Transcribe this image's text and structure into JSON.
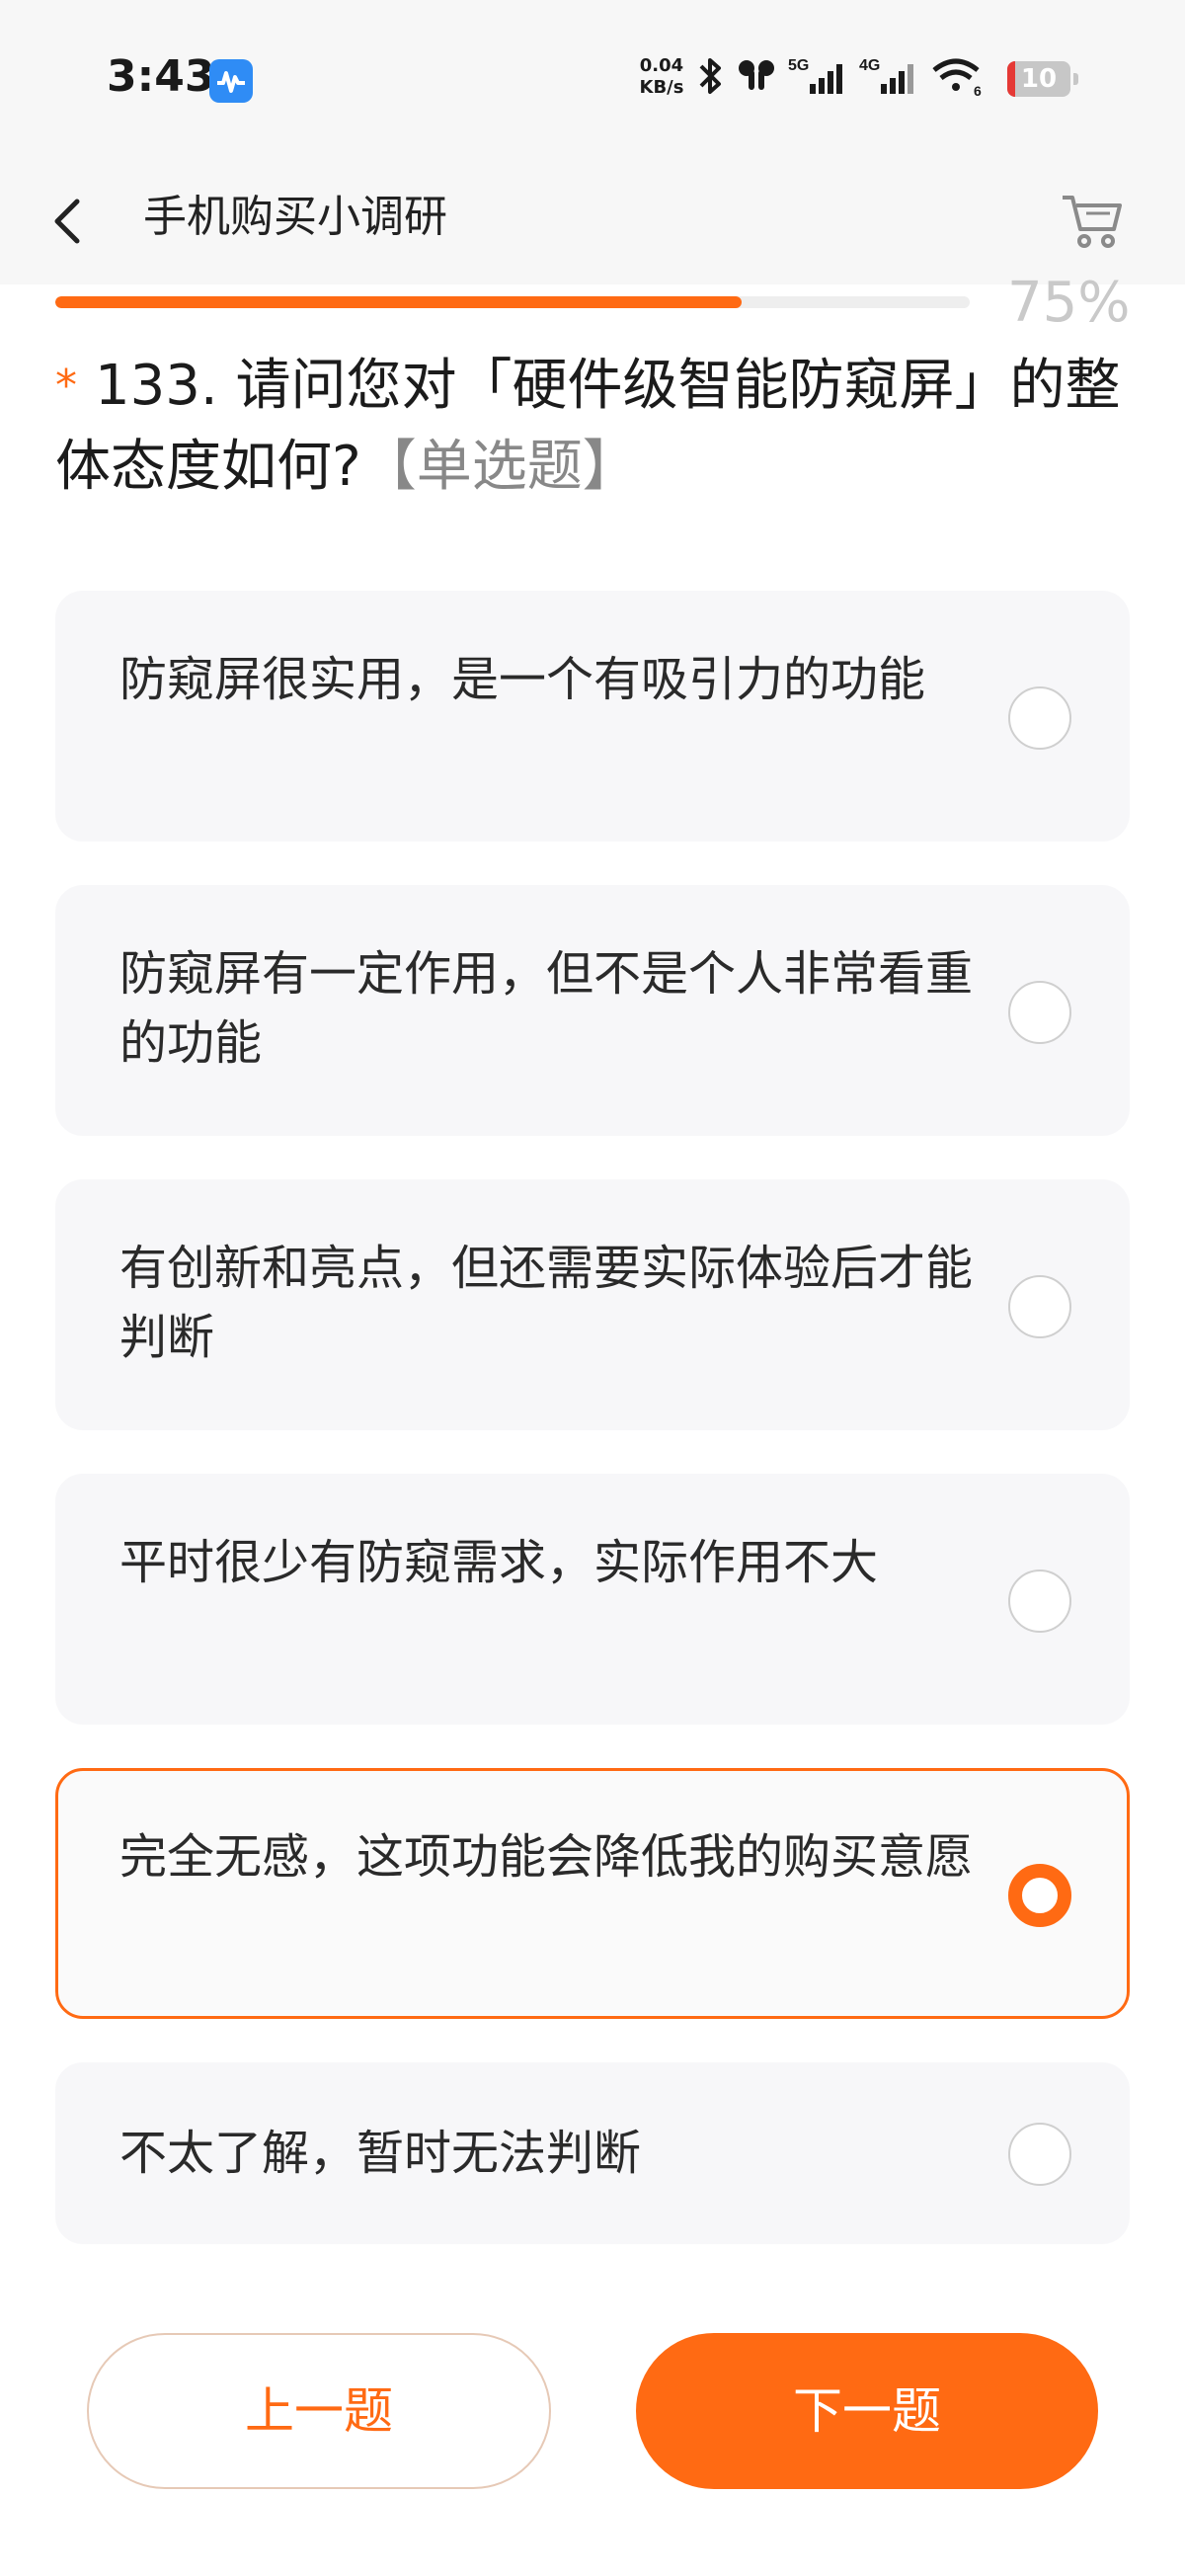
{
  "status_bar": {
    "time": "3:43",
    "net_speed_value": "0.04",
    "net_speed_unit": "KB/s",
    "network_5g": "5G",
    "network_4g": "4G",
    "wifi_label": "6",
    "battery": "10"
  },
  "header": {
    "title": "手机购买小调研"
  },
  "progress": {
    "percent_label": "75%",
    "fraction": 0.75
  },
  "question": {
    "star": "*",
    "text": "133. 请问您对「硬件级智能防窥屏」的整体态度如何?",
    "type_label": "【单选题】"
  },
  "options": [
    {
      "label": "防窥屏很实用，是一个有吸引力的功能",
      "selected": false
    },
    {
      "label": "防窥屏有一定作用，但不是个人非常看重的功能",
      "selected": false
    },
    {
      "label": "有创新和亮点，但还需要实际体验后才能判断",
      "selected": false
    },
    {
      "label": "平时很少有防窥需求，实际作用不大",
      "selected": false
    },
    {
      "label": "完全无感，这项功能会降低我的购买意愿",
      "selected": true
    },
    {
      "label": "不太了解，暂时无法判断",
      "selected": false
    }
  ],
  "footer": {
    "prev_label": "上一题",
    "next_label": "下一题"
  },
  "colors": {
    "accent": "#ff6a13",
    "option_bg": "#f7f7f9"
  }
}
